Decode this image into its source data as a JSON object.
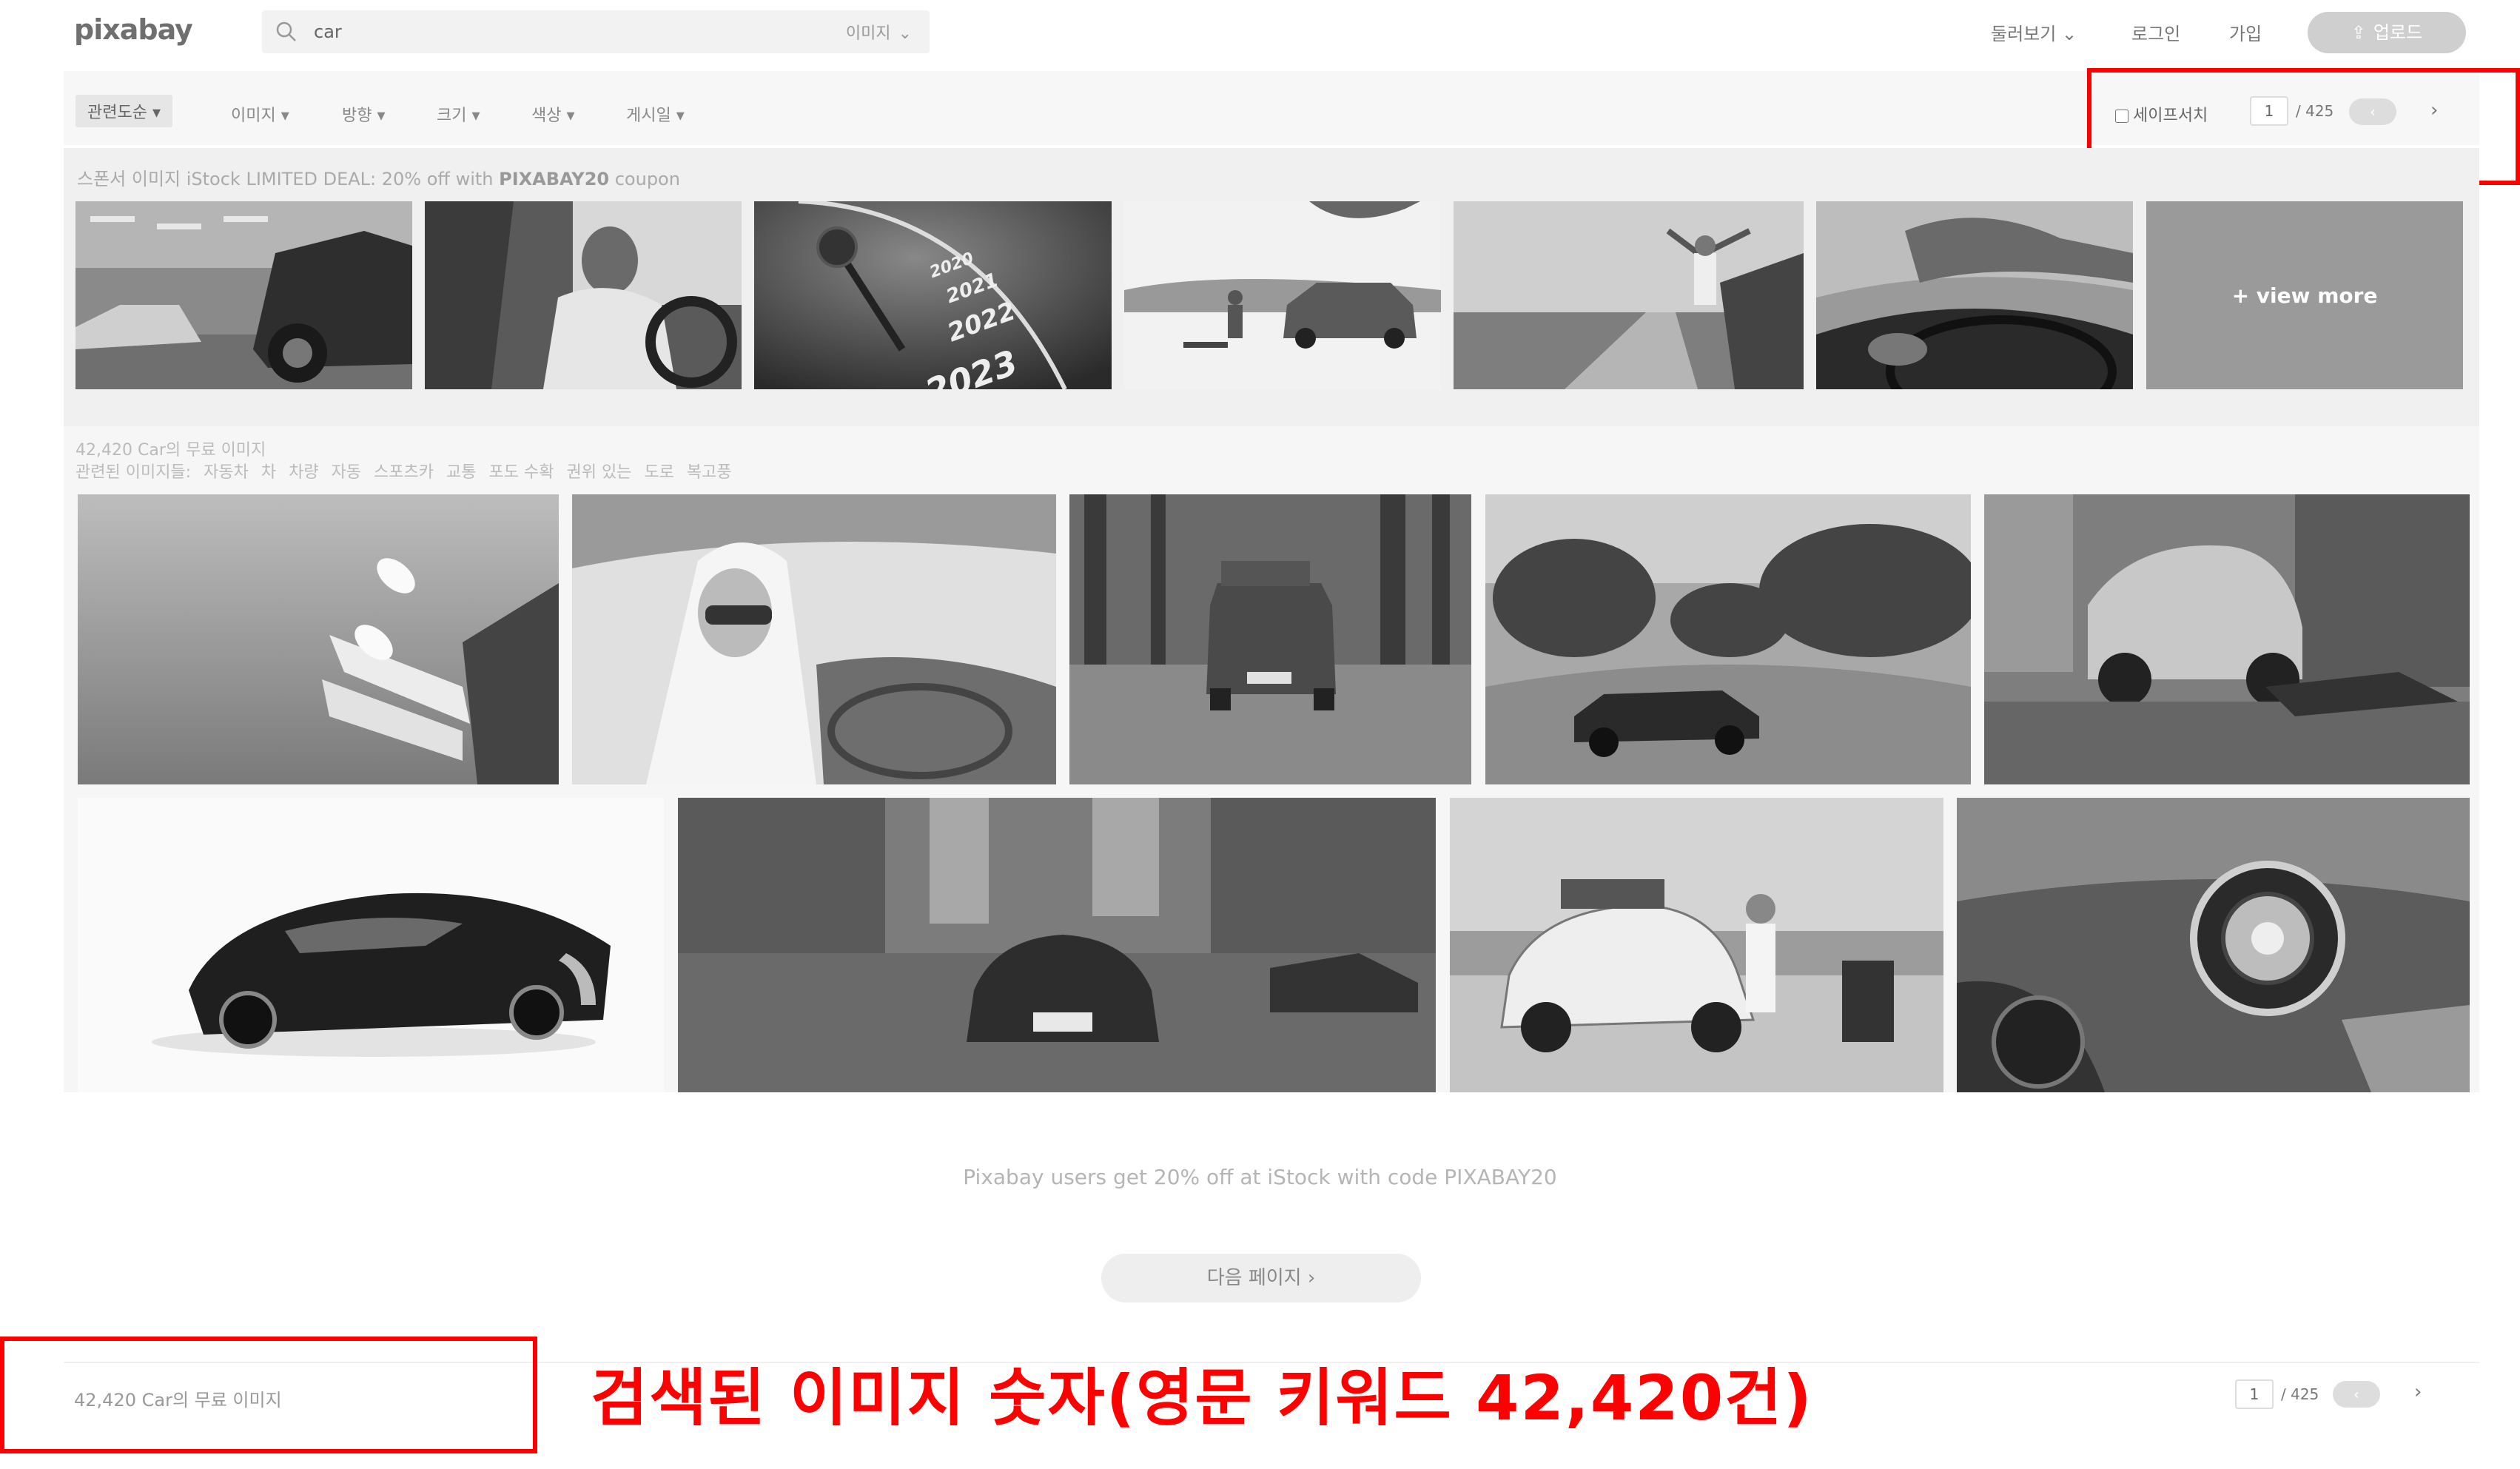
{
  "header": {
    "logo": "pixabay",
    "search_value": "car",
    "search_type": "이미지",
    "explore": "둘러보기",
    "login": "로그인",
    "join": "가입",
    "upload": "업로드"
  },
  "filters": {
    "sort": "관련도순 ▾",
    "type": "이미지 ▾",
    "orientation": "방향 ▾",
    "size": "크기 ▾",
    "color": "색상 ▾",
    "date": "게시일 ▾",
    "safesearch": "세이프서치"
  },
  "pagination": {
    "current": "1",
    "total": "/ 425",
    "prev": "‹",
    "next": "›"
  },
  "sponsor": {
    "prefix": "스폰서 이미지 iStock LIMITED DEAL: 20% off with ",
    "code": "PIXABAY20",
    "suffix": " coupon",
    "view_more": "+ view more",
    "speedometer_labels": [
      "2020",
      "2021",
      "2022",
      "2023"
    ]
  },
  "results": {
    "count": "42,420 Car의 무료 이미지",
    "related_label": "관련된 이미지들:",
    "related_tags": [
      "자동차",
      "차",
      "차량",
      "자동",
      "스포츠카",
      "교통",
      "포도 수확",
      "권위 있는",
      "도로",
      "복고풍"
    ]
  },
  "promo": "Pixabay users get 20% off at iStock with code PIXABAY20",
  "next_page": "다음 페이지 ›",
  "footer_count": "42,420 Car의 무료 이미지",
  "annotation": "검색된 이미지 숫자(영문 키워드 42,420건)"
}
